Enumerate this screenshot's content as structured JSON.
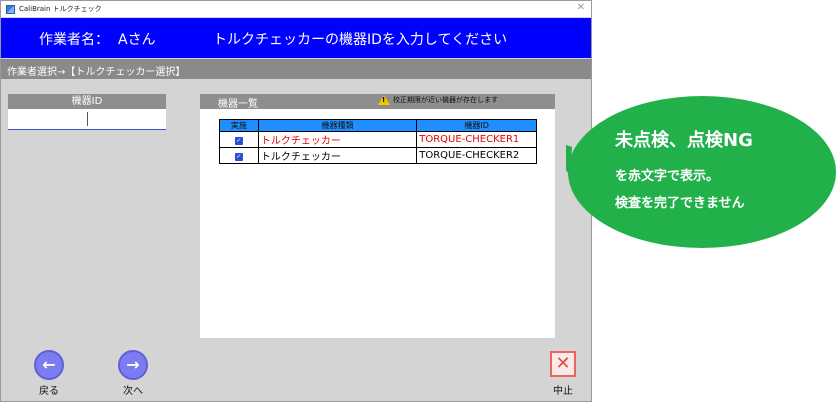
{
  "window": {
    "title": "CaliBrain トルクチェック"
  },
  "header": {
    "worker_label": "作業者名：",
    "worker_name": "Aさん",
    "message": "トルクチェッカーの機器IDを入力してください"
  },
  "breadcrumb": "作業者選択→【トルクチェッカー選択】",
  "left_panel": {
    "heading": "機器ID",
    "input_value": ""
  },
  "list_panel": {
    "title": "機器一覧",
    "warning": "校正期限が近い機器が存在します",
    "columns": [
      "実施",
      "機器種類",
      "機器ID"
    ],
    "rows": [
      {
        "checked": true,
        "type": "トルクチェッカー",
        "id": "TORQUE-CHECKER1",
        "highlight": true
      },
      {
        "checked": true,
        "type": "トルクチェッカー",
        "id": "TORQUE-CHECKER2",
        "highlight": false
      }
    ]
  },
  "footer": {
    "back": "戻る",
    "next": "次へ",
    "stop": "中止"
  },
  "callout": {
    "line1": "未点検、点検NG",
    "line2": "を赤文字で表示。",
    "line3": "検査を完了できません"
  },
  "colors": {
    "header_bg": "#0000ff",
    "table_header_bg": "#1f8fff",
    "callout_bg": "#22b04b",
    "warning_text": "#e60000"
  }
}
